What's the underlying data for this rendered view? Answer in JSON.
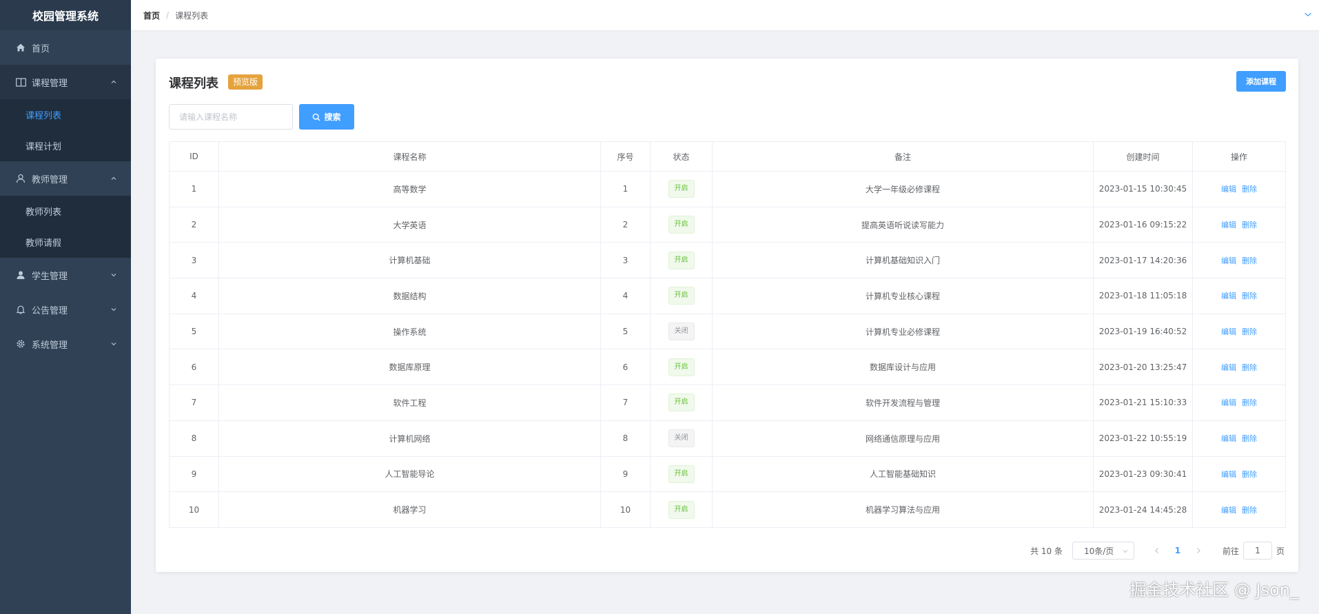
{
  "app": {
    "title": "校园管理系统"
  },
  "sidebar": {
    "home": "首页",
    "course_mgmt": {
      "label": "课程管理",
      "children": [
        "课程列表",
        "课程计划"
      ]
    },
    "teacher_mgmt": {
      "label": "教师管理",
      "children": [
        "教师列表",
        "教师请假"
      ]
    },
    "student_mgmt": "学生管理",
    "notice_mgmt": "公告管理",
    "system_mgmt": "系统管理"
  },
  "breadcrumb": {
    "home": "首页",
    "sep": "/",
    "current": "课程列表"
  },
  "card": {
    "title": "课程列表",
    "tag": "预览版",
    "add_label": "添加课程"
  },
  "search": {
    "placeholder": "请输入课程名称",
    "value": "",
    "button": "搜索"
  },
  "table": {
    "headers": [
      "ID",
      "课程名称",
      "序号",
      "状态",
      "备注",
      "创建时间",
      "操作"
    ],
    "rows": [
      {
        "id": "1",
        "name": "高等数学",
        "seq": "1",
        "status": "开启",
        "on": true,
        "note": "大学一年级必修课程",
        "time": "2023-01-15 10:30:45"
      },
      {
        "id": "2",
        "name": "大学英语",
        "seq": "2",
        "status": "开启",
        "on": true,
        "note": "提高英语听说读写能力",
        "time": "2023-01-16 09:15:22"
      },
      {
        "id": "3",
        "name": "计算机基础",
        "seq": "3",
        "status": "开启",
        "on": true,
        "note": "计算机基础知识入门",
        "time": "2023-01-17 14:20:36"
      },
      {
        "id": "4",
        "name": "数据结构",
        "seq": "4",
        "status": "开启",
        "on": true,
        "note": "计算机专业核心课程",
        "time": "2023-01-18 11:05:18"
      },
      {
        "id": "5",
        "name": "操作系统",
        "seq": "5",
        "status": "关闭",
        "on": false,
        "note": "计算机专业必修课程",
        "time": "2023-01-19 16:40:52"
      },
      {
        "id": "6",
        "name": "数据库原理",
        "seq": "6",
        "status": "开启",
        "on": true,
        "note": "数据库设计与应用",
        "time": "2023-01-20 13:25:47"
      },
      {
        "id": "7",
        "name": "软件工程",
        "seq": "7",
        "status": "开启",
        "on": true,
        "note": "软件开发流程与管理",
        "time": "2023-01-21 15:10:33"
      },
      {
        "id": "8",
        "name": "计算机网络",
        "seq": "8",
        "status": "关闭",
        "on": false,
        "note": "网络通信原理与应用",
        "time": "2023-01-22 10:55:19"
      },
      {
        "id": "9",
        "name": "人工智能导论",
        "seq": "9",
        "status": "开启",
        "on": true,
        "note": "人工智能基础知识",
        "time": "2023-01-23 09:30:41"
      },
      {
        "id": "10",
        "name": "机器学习",
        "seq": "10",
        "status": "开启",
        "on": true,
        "note": "机器学习算法与应用",
        "time": "2023-01-24 14:45:28"
      }
    ],
    "ops": {
      "edit": "编辑",
      "delete": "删除"
    }
  },
  "pagination": {
    "total": "共 10 条",
    "page_size": "10条/页",
    "current": "1",
    "goto_label": "前往",
    "goto_value": "1",
    "unit": "页"
  },
  "watermark": "掘金技术社区 @ Json_",
  "colors": {
    "sidebar": "#304156",
    "primary": "#409eff",
    "tag": "#e6a23c",
    "success": "#67c23a",
    "info": "#909399"
  }
}
